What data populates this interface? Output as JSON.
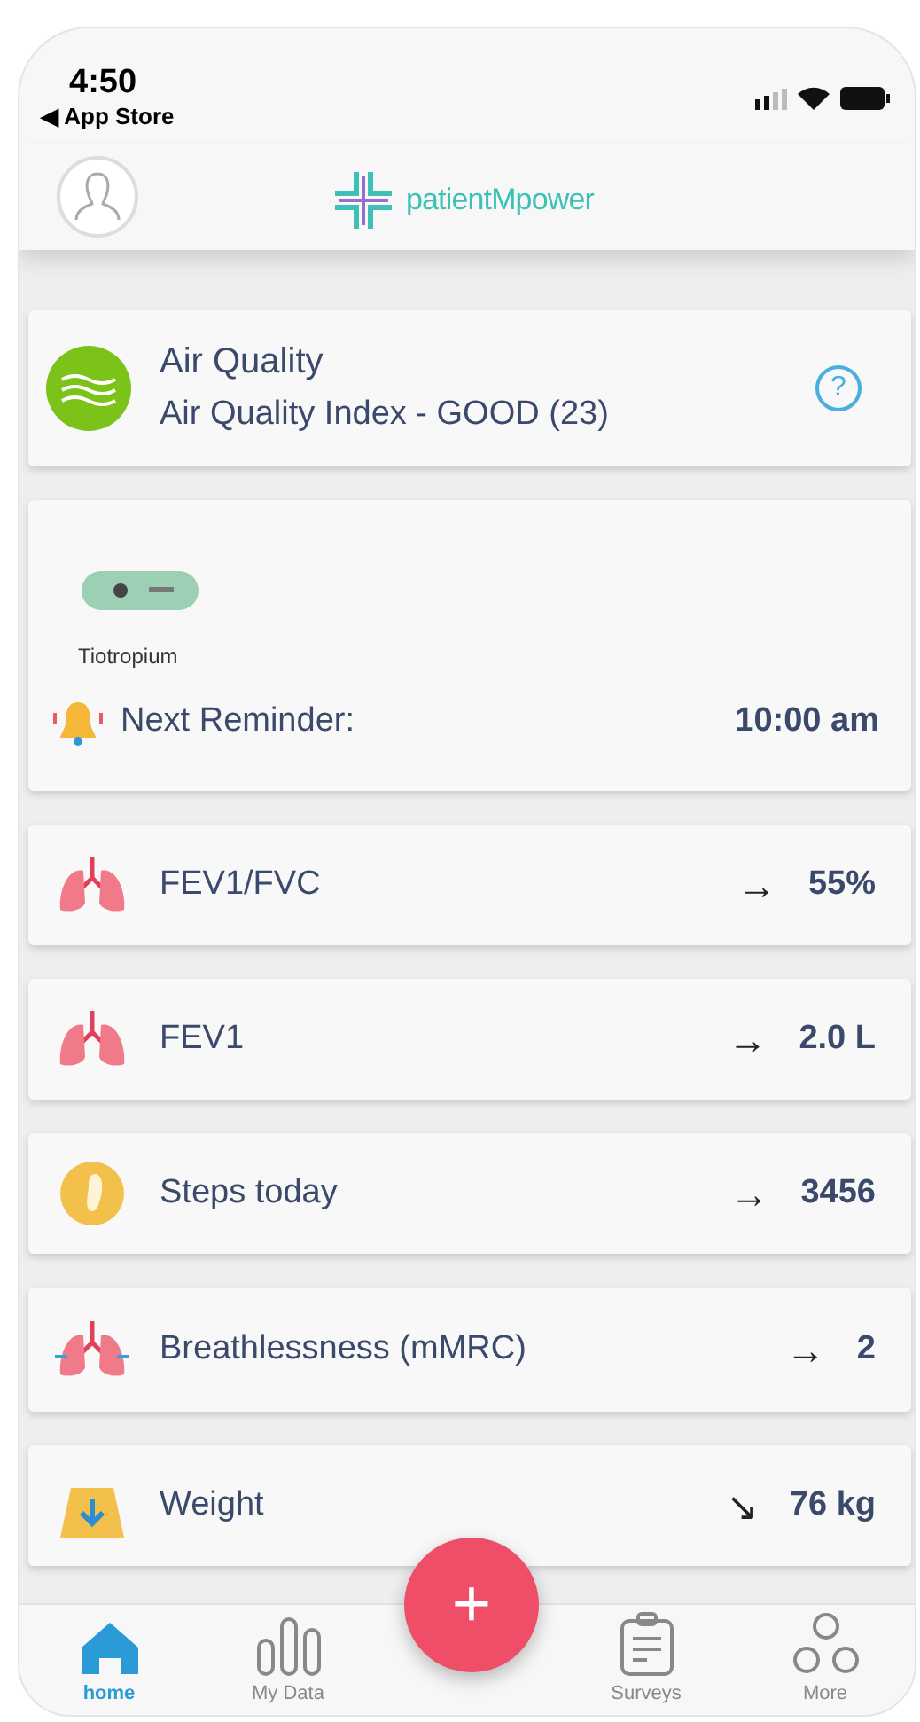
{
  "status_bar": {
    "time": "4:50",
    "back_link": "◀ App Store"
  },
  "header": {
    "brand": "patientMpower"
  },
  "air_quality": {
    "title": "Air Quality",
    "index": "Air Quality Index - GOOD (23)",
    "help": "?"
  },
  "medication": {
    "name": "Tiotropium",
    "reminder_label": "Next Reminder:",
    "reminder_time": "10:00 am"
  },
  "metrics": [
    {
      "kind": "lungs",
      "label": "FEV1/FVC",
      "trend": "→",
      "value": "55%"
    },
    {
      "kind": "lungs",
      "label": "FEV1",
      "trend": "→",
      "value": "2.0 L"
    },
    {
      "kind": "steps",
      "label": "Steps today",
      "trend": "→",
      "value": "3456"
    },
    {
      "kind": "breath",
      "label": "Breathlessness (mMRC)",
      "trend": "→",
      "value": "2"
    },
    {
      "kind": "weight",
      "label": "Weight",
      "trend": "↘",
      "value": "76 kg"
    }
  ],
  "add_button": "+",
  "nav": [
    {
      "kind": "home",
      "label": "home",
      "selected": true
    },
    {
      "kind": "data",
      "label": "My Data",
      "selected": false
    },
    {
      "kind": "gap"
    },
    {
      "kind": "surveys",
      "label": "Surveys",
      "selected": false
    },
    {
      "kind": "more",
      "label": "More",
      "selected": false
    }
  ]
}
